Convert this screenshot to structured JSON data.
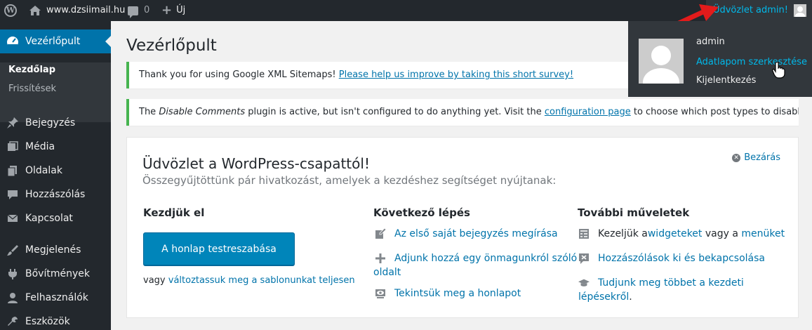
{
  "adminbar": {
    "site_name": "www.dzsiimail.hu",
    "comment_count": "0",
    "new_label": "Új",
    "greeting": "Üdvözlet admin!"
  },
  "dropdown": {
    "username": "admin",
    "edit_profile": "Adatlapom szerkesztése",
    "logout": "Kijelentkezés"
  },
  "sidebar": {
    "dashboard": "Vezérlőpult",
    "sub": [
      "Kezdőlap",
      "Frissítések"
    ],
    "items": [
      "Bejegyzés",
      "Média",
      "Oldalak",
      "Hozzászólás",
      "Kapcsolat",
      "Megjelenés",
      "Bővítmények",
      "Felhasználók",
      "Eszközök"
    ]
  },
  "page": {
    "title": "Vezérlőpult"
  },
  "notices": {
    "n1_text": "Thank you for using Google XML Sitemaps! ",
    "n1_link": "Please help us improve by taking this short survey!",
    "n2_pre": "The ",
    "n2_em": "Disable Comments",
    "n2_mid": " plugin is active, but isn't configured to do anything yet. Visit the ",
    "n2_link": "configuration page",
    "n2_post": " to choose which post types to disable comments on."
  },
  "welcome": {
    "title": "Üdvözlet a WordPress-csapattól!",
    "about": "Összegyűjtöttünk pár hivatkozást, amelyek a kezdéshez segítséget nyújtanak:",
    "dismiss": "Bezárás",
    "col1": {
      "heading": "Kezdjük el",
      "button": "A honlap testreszabása",
      "alt_pre": "vagy ",
      "alt_link": "változtassuk meg a sablonunkat teljesen"
    },
    "col2": {
      "heading": "Következő lépés",
      "a1": "Az első saját bejegyzés megírása",
      "a2_l1": "Adjunk hozzá egy önmagunkról szóló",
      "a2_l2": "oldalt",
      "a3": "Tekintsük meg a honlapot"
    },
    "col3": {
      "heading": "További műveletek",
      "b1_pre": "Kezeljük a ",
      "b1_link1": "widgeteket",
      "b1_mid": " vagy a ",
      "b1_link2": "menüket",
      "b2": "Hozzászólások ki és bekapcsolása",
      "b3_l1": "Tudjunk meg többet a kezdeti",
      "b3_l2": "lépésekről",
      "b3_dot": "."
    }
  },
  "colors": {
    "adminbar_bg": "#23282d",
    "accent": "#0073aa",
    "button": "#0085ba",
    "notice_border": "#46b450",
    "annotation_arrow": "#e21b1b"
  }
}
